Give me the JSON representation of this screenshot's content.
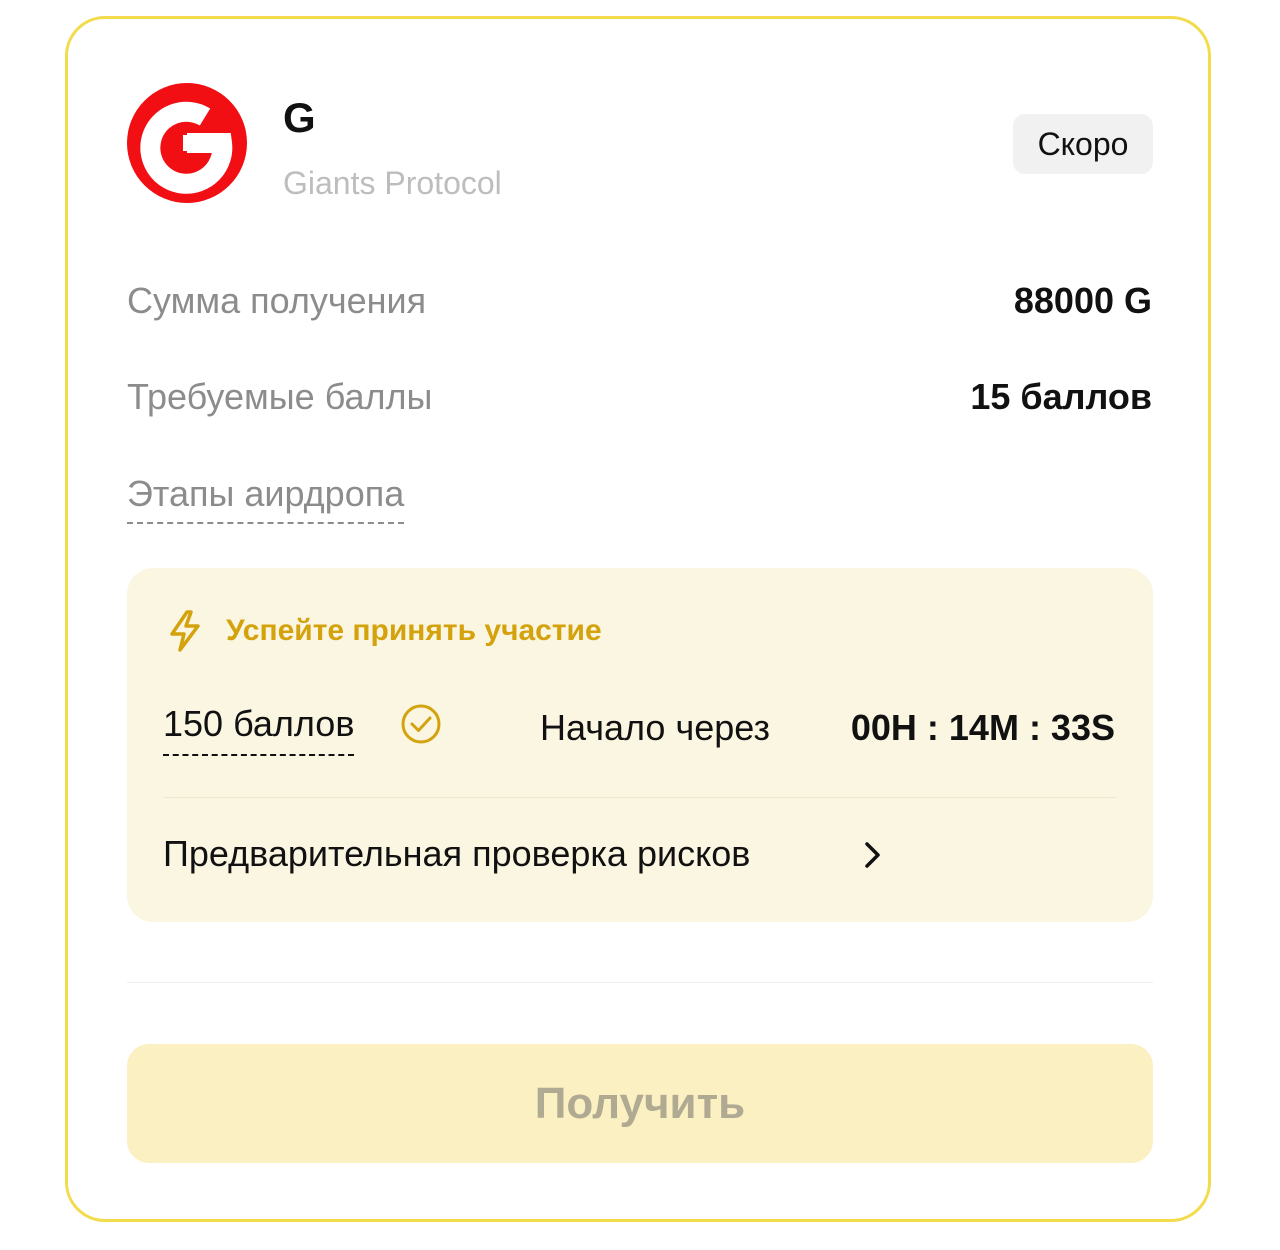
{
  "token": {
    "symbol": "G",
    "name": "Giants Protocol",
    "logo_icon": "giants-protocol-logo",
    "logo_color": "#f10f14"
  },
  "status_badge": "Скоро",
  "rows": [
    {
      "label": "Сумма получения",
      "value": "88000 G"
    },
    {
      "label": "Требуемые баллы",
      "value": "15 баллов"
    }
  ],
  "stages_label": "Этапы аирдропа",
  "promo": {
    "icon": "lightning-bolt-icon",
    "title": "Успейте принять участие",
    "title_color": "#d4a20d",
    "points": "150 баллов",
    "points_icon": "check-circle-icon",
    "countdown_label": "Начало через",
    "countdown_value": "00H : 14M : 33S",
    "risk_link": "Предварительная проверка рисков",
    "risk_link_icon": "chevron-right-icon"
  },
  "claim_button": "Получить",
  "colors": {
    "border": "#f3dc4c",
    "promo_bg": "#fbf6e2",
    "button_bg": "#fbf0c1"
  }
}
